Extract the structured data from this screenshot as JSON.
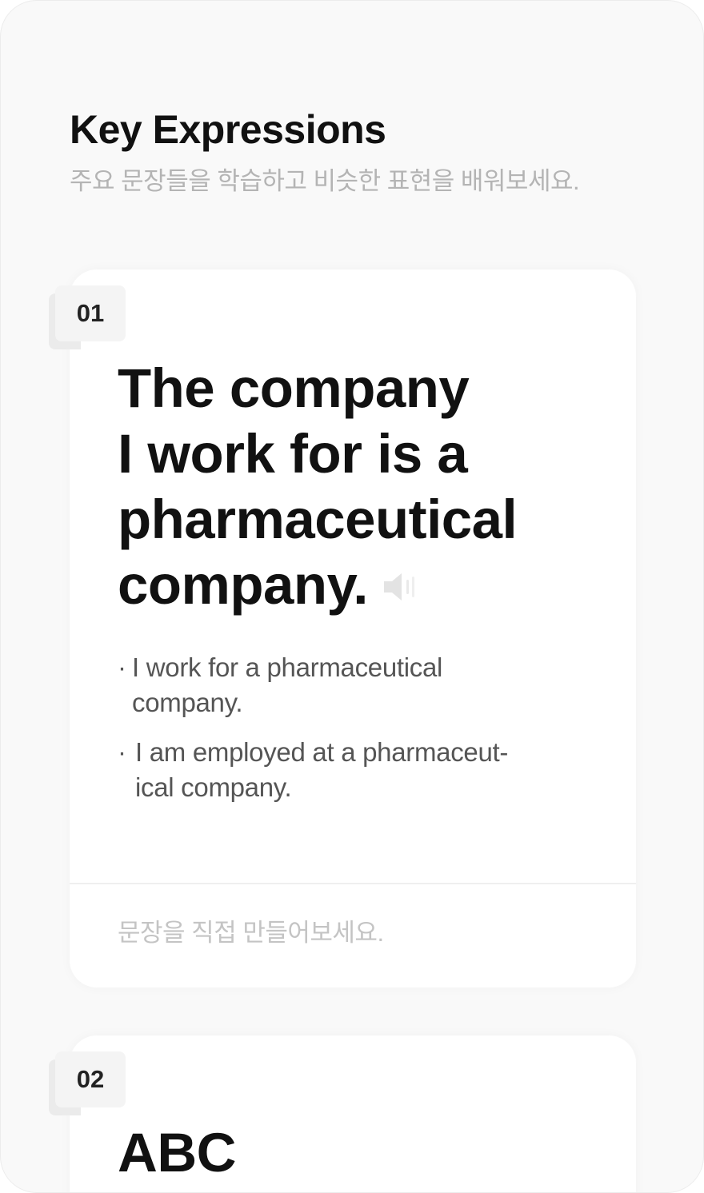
{
  "header": {
    "title": "Key Expressions",
    "subtitle": "주요 문장들을 학습하고 비슷한 표현을 배워보세요."
  },
  "expressions": [
    {
      "number": "01",
      "sentence_lines": [
        "The company",
        "I work for is a",
        "pharmaceutical",
        "company."
      ],
      "speaker_icon": "speaker-icon",
      "alternatives": [
        {
          "bullet": "·",
          "lines": [
            "I work for a pharmaceutical",
            "company."
          ]
        },
        {
          "bullet": "·",
          "lines": [
            "I am employed at a pharmaceut-",
            "ical company."
          ]
        }
      ],
      "input_placeholder": "문장을 직접 만들어보세요."
    },
    {
      "number": "02",
      "sentence_lines": [
        "ABC"
      ]
    }
  ],
  "colors": {
    "background": "#f9f9f9",
    "card": "#ffffff",
    "title": "#111111",
    "subtitle": "#b4b4b4",
    "alternative_text": "#555555",
    "placeholder": "#c4c4c4"
  }
}
